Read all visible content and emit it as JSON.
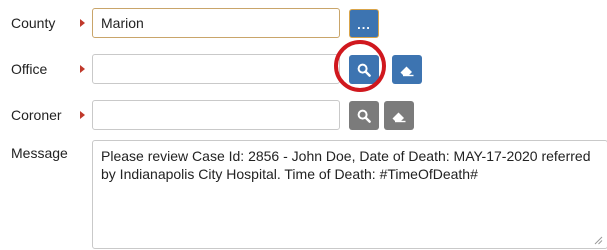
{
  "form": {
    "county": {
      "label": "County",
      "value": "Marion"
    },
    "office": {
      "label": "Office",
      "value": "",
      "placeholder": ""
    },
    "coroner": {
      "label": "Coroner",
      "value": "",
      "placeholder": ""
    },
    "message": {
      "label": "Message",
      "value": "Please review Case Id: 2856 - John Doe, Date of Death: MAY-17-2020 referred by Indianapolis City Hospital. Time of Death: #TimeOfDeath#"
    }
  },
  "buttons": {
    "county_more_label": "...",
    "office_search_icon": "search-icon",
    "office_clear_icon": "eraser-icon",
    "coroner_search_icon": "search-icon",
    "coroner_clear_icon": "eraser-icon"
  },
  "colors": {
    "required_marker": "#c0392b",
    "button_blue": "#3d74b1",
    "button_gray": "#7b7b7b",
    "highlight_ring": "#d0181e",
    "focus_border": "#c9a56a"
  }
}
